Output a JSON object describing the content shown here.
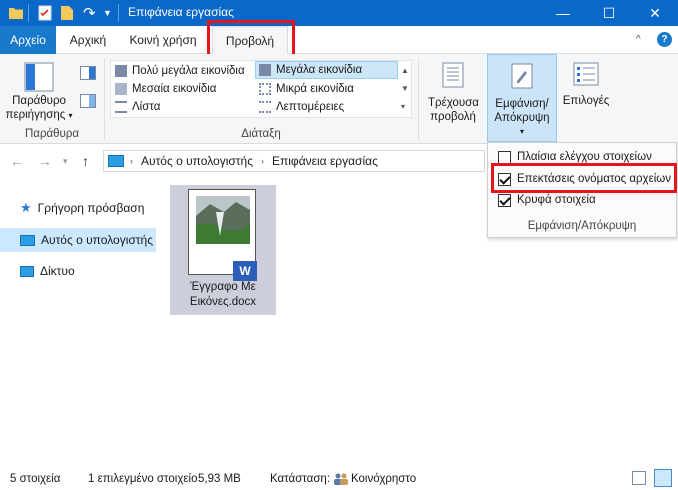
{
  "window": {
    "title": "Επιφάνεια εργασίας",
    "minimize_icon": "—",
    "maximize_icon": "☐",
    "close_icon": "✕"
  },
  "tabs": {
    "file": "Αρχείο",
    "home": "Αρχική",
    "share": "Κοινή χρήση",
    "view": "Προβολή"
  },
  "ribbon": {
    "panes": {
      "preview_pane_label": "Παράθυρο περιήγησης",
      "group_label": "Παράθυρα"
    },
    "layout": {
      "items": [
        "Πολύ μεγάλα εικονίδια",
        "Μεσαία εικονίδια",
        "Λίστα",
        "Μεγάλα εικονίδια",
        "Μικρά εικονίδια",
        "Λεπτομέρειες"
      ],
      "selected": "Μεγάλα εικονίδια",
      "group_label": "Διάταξη"
    },
    "current_view_label": "Τρέχουσα προβολή",
    "show_hide_label": "Εμφάνιση/ Απόκρυψη",
    "options_label": "Επιλογές"
  },
  "show_hide_panel": {
    "items": [
      {
        "label": "Πλαίσια ελέγχου στοιχείων",
        "checked": false
      },
      {
        "label": "Επεκτάσεις ονόματος αρχείων",
        "checked": true
      },
      {
        "label": "Κρυφά στοιχεία",
        "checked": true
      }
    ],
    "group_label": "Εμφάνιση/Απόκρυψη"
  },
  "address": {
    "path": [
      "Αυτός ο υπολογιστής",
      "Επιφάνεια εργασίας"
    ]
  },
  "nav_pane": {
    "items": [
      {
        "label": "Γρήγορη πρόσβαση",
        "icon": "star-icon"
      },
      {
        "label": "Αυτός ο υπολογιστής",
        "icon": "computer-icon"
      },
      {
        "label": "Δίκτυο",
        "icon": "network-icon"
      }
    ]
  },
  "files": [
    {
      "name_line1": "Έγγραφο Με",
      "name_line2": "Εικόνες.docx",
      "type": "word"
    }
  ],
  "status": {
    "count": "5 στοιχεία",
    "selected": "1 επιλεγμένο στοιχείο",
    "size": "5,93 MB",
    "state_label": "Κατάσταση:",
    "state_value": "Κοινόχρηστο"
  },
  "colors": {
    "titlebar": "#0a68c8",
    "highlight": "#e8141c",
    "selected_bg": "#cde6f7"
  }
}
